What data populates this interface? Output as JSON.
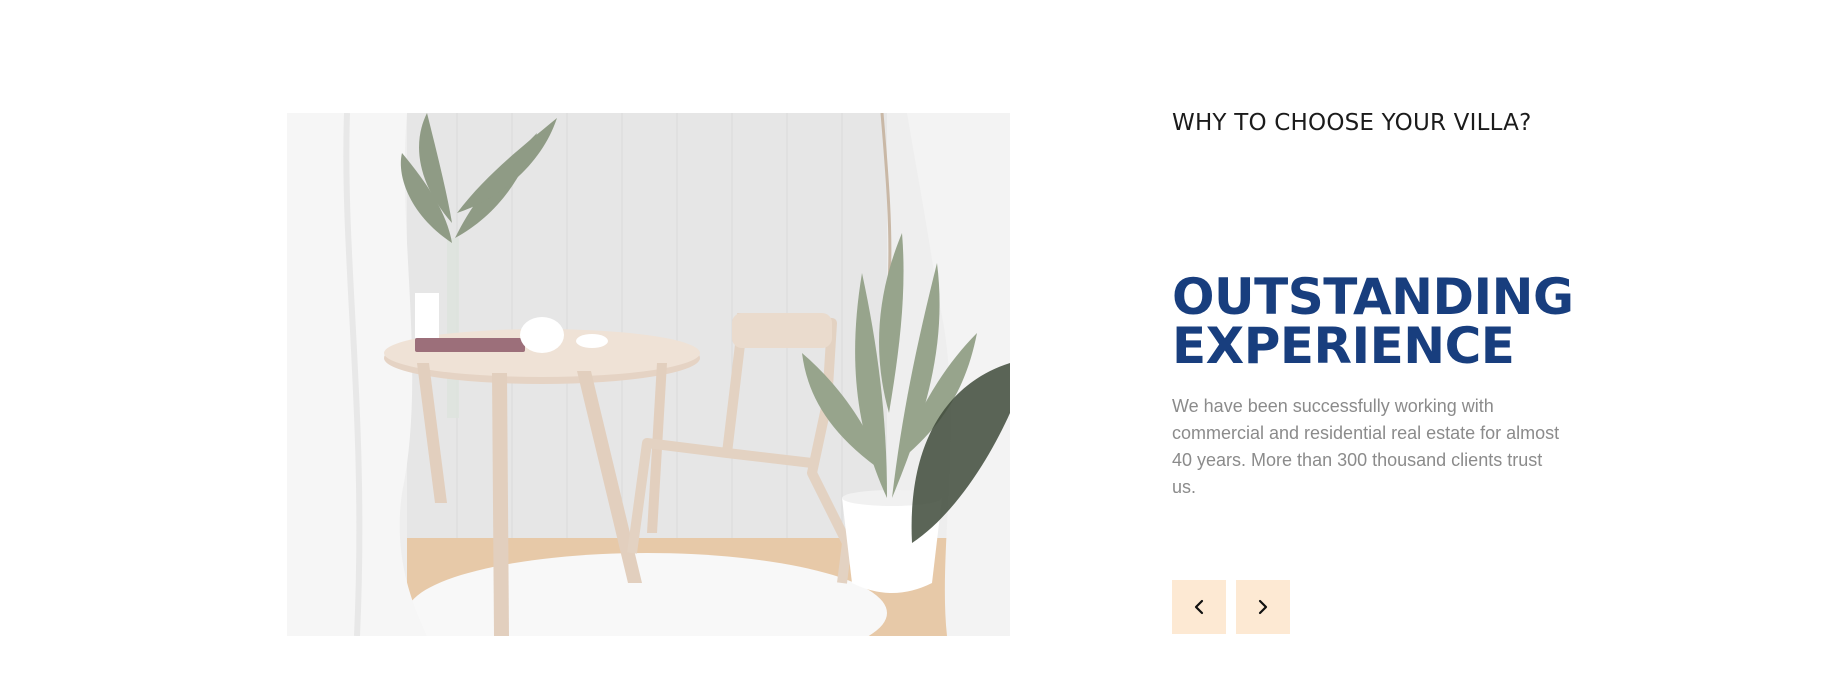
{
  "section": {
    "eyebrow": "WHY TO CHOOSE YOUR VILLA?",
    "headline_line1": "OUTSTANDING",
    "headline_line2": "EXPERIENCE",
    "description": "We have been successfully working with commercial and residential real estate for almost 40 years. More than 300 thousand clients trust us."
  },
  "slider": {
    "prev_icon": "chevron-left-icon",
    "next_icon": "chevron-right-icon"
  },
  "colors": {
    "accent": "#183e7e",
    "button_bg": "#fde9d3",
    "text_muted": "#8b8b8b",
    "text_dark": "#1b1b1b"
  }
}
